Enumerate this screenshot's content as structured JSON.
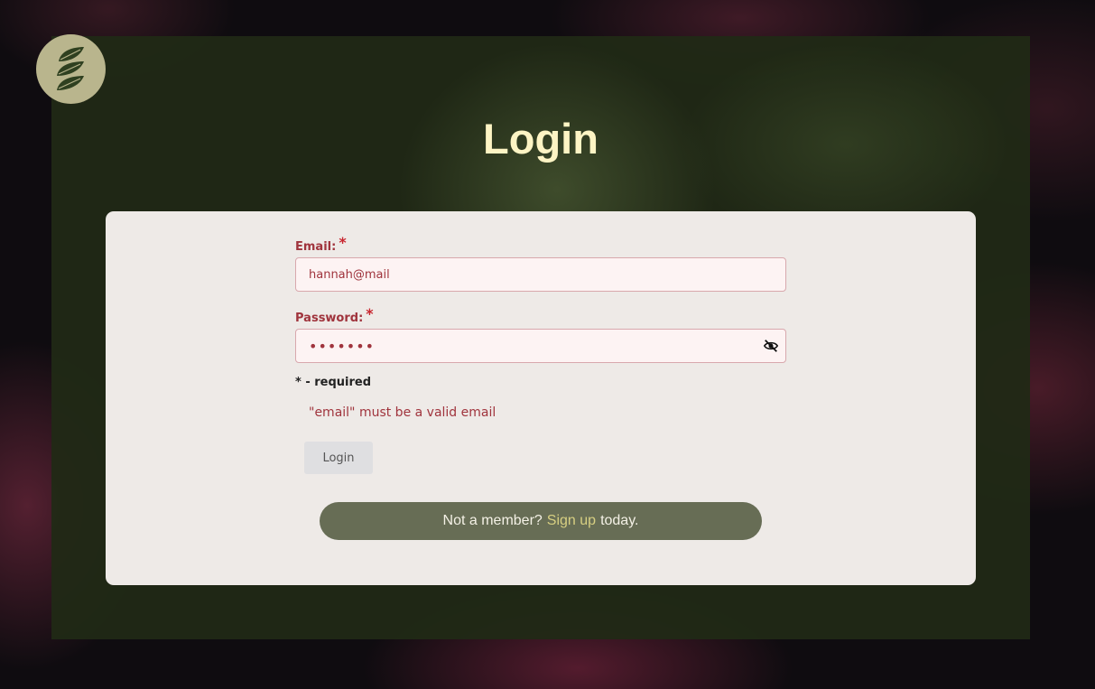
{
  "logo": {
    "icon": "leaf-icon",
    "bg": "#b9b58d",
    "leaf_color": "#2f4020"
  },
  "page_title": "Login",
  "form": {
    "email": {
      "label": "Email:",
      "required_mark": "*",
      "value": "hannah@mail"
    },
    "password": {
      "label": "Password:",
      "required_mark": "*",
      "value": "•••••••",
      "toggle_icon": "eye-slash-icon"
    },
    "required_note": "* - required",
    "error_message": "\"email\" must be a valid email",
    "submit_label": "Login"
  },
  "signup": {
    "prefix": "Not a member?",
    "link": "Sign up",
    "suffix": "today."
  },
  "colors": {
    "accent": "#a0343d",
    "title": "#fdf4c4",
    "link": "#d7cf82",
    "pill": "#676d55"
  }
}
